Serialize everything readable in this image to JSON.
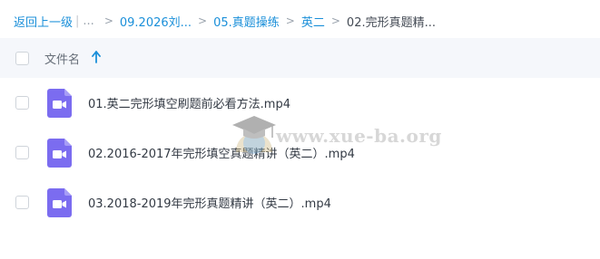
{
  "breadcrumb": {
    "back_label": "返回上一级",
    "pipe": "|",
    "ellipsis": "...",
    "separator": ">",
    "items": [
      {
        "label": "09.2026刘..."
      },
      {
        "label": "05.真题操练"
      },
      {
        "label": "英二"
      }
    ],
    "current": "02.完形真题精..."
  },
  "table": {
    "header_label": "文件名",
    "sort_direction": "ascending",
    "sort_icon": "arrow-up-icon"
  },
  "files": [
    {
      "name": "01.英二完形填空刷题前必看方法.mp4",
      "icon": "video-file-icon"
    },
    {
      "name": "02.2016-2017年完形填空真题精讲（英二）.mp4",
      "icon": "video-file-icon"
    },
    {
      "name": "03.2018-2019年完形真题精讲（英二）.mp4",
      "icon": "video-file-icon"
    }
  ],
  "watermark": {
    "text": "www.xue-ba.org",
    "icon": "graduation-cap-icon"
  },
  "colors": {
    "link": "#1a8fd9",
    "header_bg": "#f5f7fb",
    "video_icon": "#7b6cf0",
    "video_icon_fold": "#a79df6"
  }
}
